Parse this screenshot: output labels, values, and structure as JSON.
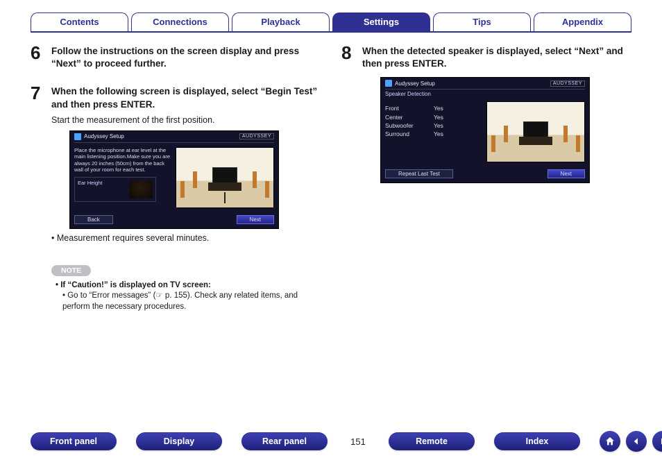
{
  "tabs": {
    "contents": "Contents",
    "connections": "Connections",
    "playback": "Playback",
    "settings": "Settings",
    "tips": "Tips",
    "appendix": "Appendix",
    "active": "settings"
  },
  "left": {
    "step6": {
      "num": "6",
      "heading": "Follow the instructions on the screen display and press “Next” to proceed further."
    },
    "step7": {
      "num": "7",
      "heading": "When the following screen is displayed, select “Begin Test” and then press ENTER.",
      "sub": "Start the measurement of the first position."
    },
    "shot1": {
      "title": "Audyssey Setup",
      "brand": "AUDYSSEY",
      "body": "Place the microphone at ear level at the main listening position.Make sure you are always 20 inches (50cm) from the back wall of your room for each test.",
      "ear_label": "Ear Height",
      "back": "Back",
      "next": "Next"
    },
    "bullet": "Measurement requires several minutes.",
    "note_chip": "NOTE",
    "note_b1": "If “Caution!” is displayed on TV screen:",
    "note_b2": "Go to “Error messages” (☞ p. 155). Check any related items, and perform the necessary procedures."
  },
  "right": {
    "step8": {
      "num": "8",
      "heading": "When the detected speaker is displayed, select “Next” and then press ENTER."
    },
    "shot2": {
      "title": "Audyssey Setup",
      "brand": "AUDYSSEY",
      "subtitle": "Speaker Detection",
      "rows": [
        {
          "name": "Front",
          "val": "Yes"
        },
        {
          "name": "Center",
          "val": "Yes"
        },
        {
          "name": "Subwoofer",
          "val": "Yes"
        },
        {
          "name": "Surround",
          "val": "Yes"
        }
      ],
      "repeat": "Repeat Last Test",
      "next": "Next"
    }
  },
  "footer": {
    "front_panel": "Front panel",
    "display": "Display",
    "rear_panel": "Rear panel",
    "page": "151",
    "remote": "Remote",
    "index": "Index"
  }
}
